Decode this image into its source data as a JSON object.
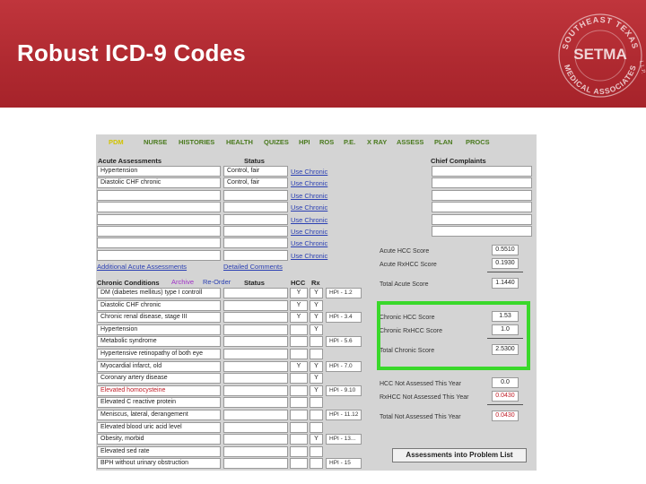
{
  "slide": {
    "title": "Robust ICD-9 Codes"
  },
  "logo": {
    "top_text": "SOUTHEAST TEXAS",
    "mid_text": "SETMA",
    "bottom_text": "MEDICAL ASSOCIATES",
    "suffix": "L.L.P."
  },
  "nav": [
    "PDM",
    "NURSE",
    "HISTORIES",
    "HEALTH",
    "QUIZES",
    "HPI",
    "ROS",
    "P.E.",
    "X RAY",
    "ASSESS",
    "PLAN",
    "PROCS"
  ],
  "acute": {
    "header": "Acute Assessments",
    "status_header": "Status",
    "rows": [
      {
        "name": "Hypertension",
        "status": "Control, fair"
      },
      {
        "name": "Diastolic CHF chronic",
        "status": "Control, fair"
      },
      {
        "name": "",
        "status": ""
      },
      {
        "name": "",
        "status": ""
      },
      {
        "name": "",
        "status": ""
      },
      {
        "name": "",
        "status": ""
      },
      {
        "name": "",
        "status": ""
      },
      {
        "name": "",
        "status": ""
      }
    ],
    "use_chronic": "Use Chronic",
    "additional_link": "Additional Acute Assessments",
    "detailed_link": "Detailed Comments"
  },
  "chief_complaints": {
    "header": "Chief Complaints"
  },
  "chronic": {
    "header": "Chronic Conditions",
    "archive": "Archive",
    "reorder": "Re-Order",
    "status_header": "Status",
    "hcc_header": "HCC",
    "rx_header": "Rx",
    "rows": [
      {
        "name": "DM (diabetes mellitus) type I controll",
        "hcc": "Y",
        "rx": "Y",
        "code": "HPI - 1.2",
        "red": false
      },
      {
        "name": "Diastolic CHF chronic",
        "hcc": "Y",
        "rx": "Y",
        "code": "",
        "red": false
      },
      {
        "name": "Chronic renal disease, stage III",
        "hcc": "Y",
        "rx": "Y",
        "code": "HPI - 3.4",
        "red": false
      },
      {
        "name": "Hypertension",
        "hcc": "",
        "rx": "Y",
        "code": "",
        "red": false
      },
      {
        "name": "Metabolic syndrome",
        "hcc": "",
        "rx": "",
        "code": "HPI - 5.6",
        "red": false
      },
      {
        "name": "Hypertensive retinopathy of both eye",
        "hcc": "",
        "rx": "",
        "code": "",
        "red": false
      },
      {
        "name": "Myocardial infarct, old",
        "hcc": "Y",
        "rx": "Y",
        "code": "HPI - 7.0",
        "red": false
      },
      {
        "name": "Coronary artery disease",
        "hcc": "",
        "rx": "Y",
        "code": "",
        "red": false
      },
      {
        "name": "Elevated homocysteine",
        "hcc": "",
        "rx": "Y",
        "code": "HPI - 9.10",
        "red": true
      },
      {
        "name": "Elevated C reactive protein",
        "hcc": "",
        "rx": "",
        "code": "",
        "red": false
      },
      {
        "name": "Meniscus, lateral, derangement",
        "hcc": "",
        "rx": "",
        "code": "HPI - 11.12",
        "red": false
      },
      {
        "name": "Elevated blood uric acid level",
        "hcc": "",
        "rx": "",
        "code": "",
        "red": false
      },
      {
        "name": "Obesity, morbid",
        "hcc": "",
        "rx": "Y",
        "code": "HPI - 13...",
        "red": false
      },
      {
        "name": "Elevated sed rate",
        "hcc": "",
        "rx": "",
        "code": "",
        "red": false
      },
      {
        "name": "BPH without urinary obstruction",
        "hcc": "",
        "rx": "",
        "code": "HPI - 15",
        "red": false
      }
    ]
  },
  "scores": {
    "acute_hcc_label": "Acute HCC Score",
    "acute_hcc": "0.5510",
    "acute_rxhcc_label": "Acute RxHCC Score",
    "acute_rxhcc": "0.1930",
    "total_acute_label": "Total Acute Score",
    "total_acute": "1.1440",
    "chronic_hcc_label": "Chronic HCC Score",
    "chronic_hcc": "1.53",
    "chronic_rxhcc_label": "Chronic RxHCC Score",
    "chronic_rxhcc": "1.0",
    "total_chronic_label": "Total Chronic Score",
    "total_chronic": "2.5300",
    "hcc_not_assessed_label": "HCC Not Assessed This Year",
    "hcc_not_assessed": "0.0",
    "rxhcc_not_assessed_label": "RxHCC Not Assessed This Year",
    "rxhcc_not_assessed": "0.0430",
    "total_not_assessed_label": "Total Not Assessed This Year",
    "total_not_assessed": "0.0430"
  },
  "button": {
    "label": "Assessments into Problem List"
  },
  "colors": {
    "header_red": "#b02a31",
    "highlight_green": "#39d82a",
    "link_blue": "#2a3fb3",
    "nav_green": "#4a7a1e",
    "nav_active": "#d2c300",
    "alert_red": "#c0202a"
  }
}
